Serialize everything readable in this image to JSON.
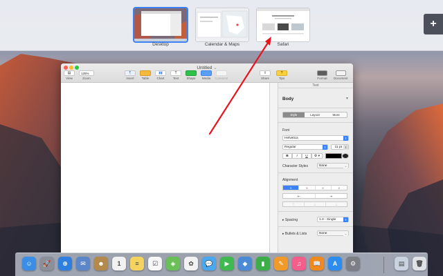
{
  "mission_control": {
    "spaces": [
      {
        "label": "Desktop",
        "active": true
      },
      {
        "label": "Calendar & Maps",
        "active": false
      },
      {
        "label": "Safari",
        "active": false
      }
    ],
    "add_space_icon": "plus-icon"
  },
  "window": {
    "title": "Untitled",
    "title_caret": "⌄",
    "toolbar": {
      "view_label": "View",
      "zoom_label": "Zoom",
      "zoom_value": "125%",
      "insert_label": "Insert",
      "table_label": "Table",
      "chart_label": "Chart",
      "text_label": "Text",
      "text_glyph": "T",
      "shape_label": "Shape",
      "media_label": "Media",
      "comment_label": "Comment",
      "share_label": "Share",
      "tips_label": "Tips",
      "format_label": "Format",
      "document_label": "Document"
    },
    "inspector": {
      "header": "Text",
      "paragraph_style": "Body",
      "tabs": [
        "Style",
        "Layout",
        "More"
      ],
      "selected_tab": "Style",
      "font_section": "Font",
      "font_family": "Helvetica",
      "font_weight": "Regular",
      "font_size": "11 pt",
      "format_buttons": [
        "B",
        "I",
        "U",
        "⚙ ▾"
      ],
      "text_color": "#000000",
      "character_styles_label": "Character Styles",
      "character_styles_value": "None",
      "alignment_section": "Alignment",
      "align_buttons": [
        "≡",
        "≡",
        "≡",
        "≡"
      ],
      "indent_buttons": [
        "⇤",
        "⇥"
      ],
      "vertical_buttons": [
        "⊤",
        "⊥",
        "⊥"
      ],
      "spacing_label": "Spacing",
      "spacing_value": "1.0 - Single",
      "bullets_label": "Bullets & Lists",
      "bullets_value": "None"
    }
  },
  "dock": {
    "apps": [
      {
        "name": "finder-icon",
        "glyph": "☺",
        "color": "#3a8ee6"
      },
      {
        "name": "launchpad-icon",
        "glyph": "🚀",
        "color": "#8a8f99"
      },
      {
        "name": "safari-icon",
        "glyph": "⊕",
        "color": "#2f7fe0"
      },
      {
        "name": "mail-stamp-icon",
        "glyph": "✉",
        "color": "#5b86c8"
      },
      {
        "name": "contacts-icon",
        "glyph": "☻",
        "color": "#b48a4c"
      },
      {
        "name": "calendar-icon",
        "glyph": "1",
        "color": "#f1f1f1"
      },
      {
        "name": "notes-icon",
        "glyph": "≡",
        "color": "#f4d35e"
      },
      {
        "name": "reminders-icon",
        "glyph": "☑",
        "color": "#f7f7f7"
      },
      {
        "name": "maps-icon",
        "glyph": "◈",
        "color": "#6bbf59"
      },
      {
        "name": "photos-icon",
        "glyph": "✿",
        "color": "#f2f2f2"
      },
      {
        "name": "messages-icon",
        "glyph": "💬",
        "color": "#4aa8f0"
      },
      {
        "name": "facetime-icon",
        "glyph": "▶",
        "color": "#3fb950"
      },
      {
        "name": "keynote-icon",
        "glyph": "◆",
        "color": "#4b8bd6"
      },
      {
        "name": "numbers-icon",
        "glyph": "▮",
        "color": "#3cae48"
      },
      {
        "name": "pages-icon",
        "glyph": "✎",
        "color": "#f09a2a"
      },
      {
        "name": "itunes-icon",
        "glyph": "♫",
        "color": "#f35e8b"
      },
      {
        "name": "ibooks-icon",
        "glyph": "📖",
        "color": "#f08a1c"
      },
      {
        "name": "app-store-icon",
        "glyph": "A",
        "color": "#2d8cf0"
      },
      {
        "name": "system-preferences-icon",
        "glyph": "⚙",
        "color": "#7c7f86"
      },
      {
        "name": "downloads-stack-icon",
        "glyph": "▤",
        "color": "#c9d3e0"
      },
      {
        "name": "trash-icon",
        "glyph": "🗑",
        "color": "#dfe3e8"
      }
    ]
  },
  "colors": {
    "accent": "#3b82f7",
    "annotation_arrow": "#e8141b"
  }
}
